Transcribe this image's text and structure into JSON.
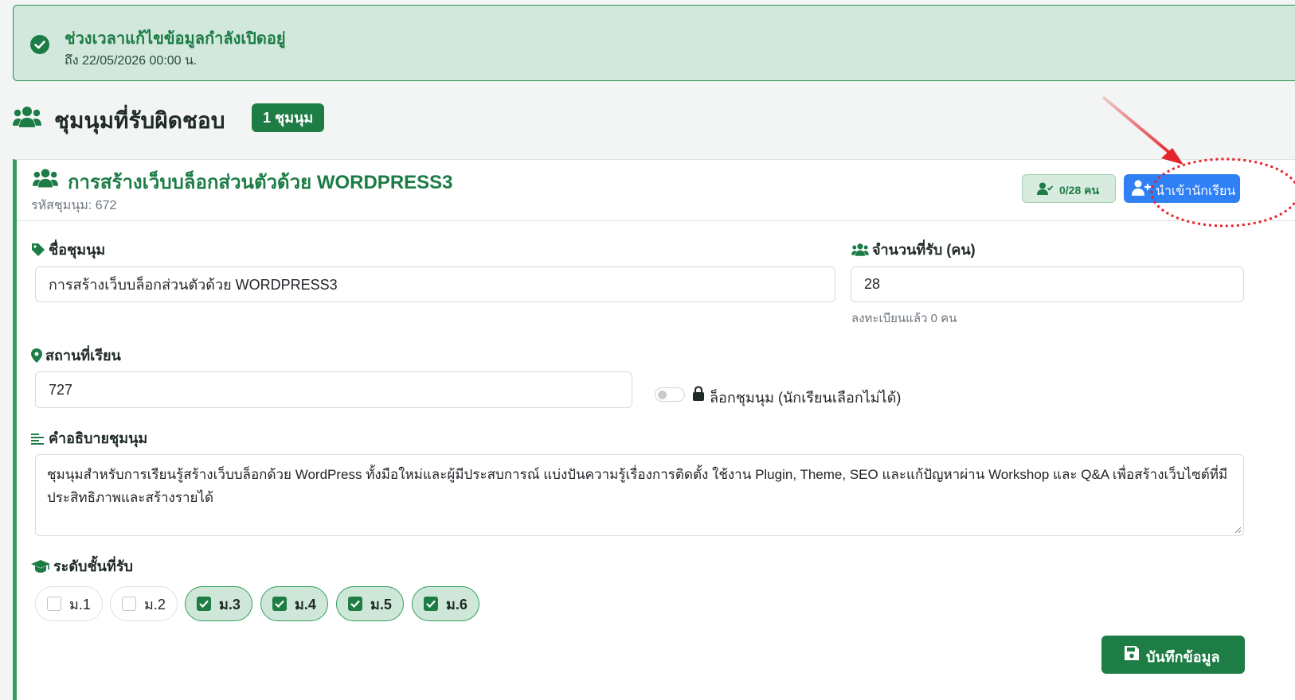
{
  "alert": {
    "title": "ช่วงเวลาแก้ไขข้อมูลกำลังเปิดอยู่",
    "subtitle": "ถึง 22/05/2026 00:00 น.",
    "icon": "check-circle-icon",
    "color": "#1c7c45"
  },
  "section": {
    "title": "ชุมนุมที่รับผิดชอบ",
    "count_badge": "1 ชุมนุม",
    "icon": "users-icon"
  },
  "club": {
    "name": "การสร้างเว็บบล็อกส่วนตัวด้วย WORDPRESS3",
    "code_label": "รหัสชุมนุม: 672",
    "capacity_badge": "0/28 คน",
    "import_button": "นำเข้านักเรียน",
    "fields": {
      "name_label": "ชื่อชุมนุม",
      "name_value": "การสร้างเว็บบล็อกส่วนตัวด้วย WORDPRESS3",
      "capacity_label": "จำนวนที่รับ (คน)",
      "capacity_value": "28",
      "registered_help": "ลงทะเบียนแล้ว 0 คน",
      "location_label": "สถานที่เรียน",
      "location_value": "727",
      "lock_label": "ล็อกชุมนุม (นักเรียนเลือกไม่ได้)",
      "lock_on": false,
      "description_label": "คำอธิบายชุมนุม",
      "description_value": "ชุมนุมสำหรับการเรียนรู้สร้างเว็บบล็อกด้วย WordPress ทั้งมือใหม่และผู้มีประสบการณ์ แบ่งปันความรู้เรื่องการติดตั้ง ใช้งาน Plugin, Theme, SEO และแก้ปัญหาผ่าน Workshop และ Q&A เพื่อสร้างเว็บไซต์ที่มีประสิทธิภาพและสร้างรายได้",
      "grades_label": "ระดับชั้นที่รับ"
    },
    "grades": [
      {
        "label": "ม.1",
        "checked": false
      },
      {
        "label": "ม.2",
        "checked": false
      },
      {
        "label": "ม.3",
        "checked": true
      },
      {
        "label": "ม.4",
        "checked": true
      },
      {
        "label": "ม.5",
        "checked": true
      },
      {
        "label": "ม.6",
        "checked": true
      }
    ],
    "save_button": "บันทึกข้อมูล"
  },
  "colors": {
    "accent": "#1e7d45",
    "primary_button": "#2f7ff5",
    "annotation": "#e3242b"
  }
}
